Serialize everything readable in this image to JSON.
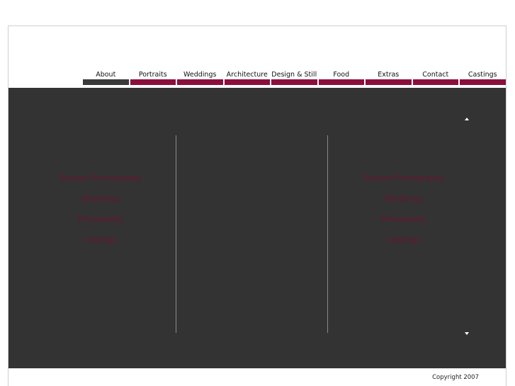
{
  "nav": {
    "items": [
      {
        "label": "About",
        "active": true
      },
      {
        "label": "Portraits",
        "active": false
      },
      {
        "label": "Weddings",
        "active": false
      },
      {
        "label": "Architecture",
        "active": false
      },
      {
        "label": "Design & Still",
        "active": false
      },
      {
        "label": "Food",
        "active": false
      },
      {
        "label": "Extras",
        "active": false
      },
      {
        "label": "Contact",
        "active": false
      },
      {
        "label": "Castings",
        "active": false
      }
    ]
  },
  "left_links": [
    "Product Photography",
    "Weddings",
    "Photobooks",
    "Castings"
  ],
  "right_links": [
    "Product Photography",
    "Weddings",
    "Photobooks",
    "Castings"
  ],
  "scroll": {
    "up_icon": "triangle-up-icon",
    "down_icon": "triangle-down-icon"
  },
  "footer": {
    "copyright": "Copyright 2007"
  },
  "colors": {
    "accent": "#8b0f3c",
    "active_tab": "#3a3a3a",
    "content_bg": "#333333",
    "link_text": "#6b1430"
  }
}
